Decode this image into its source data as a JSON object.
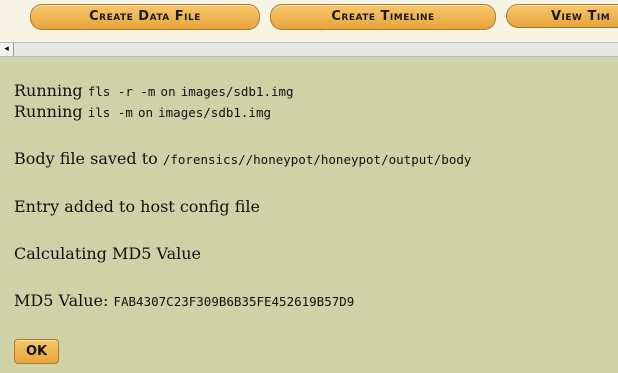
{
  "nav": {
    "tabs": [
      {
        "label": "Create Data File"
      },
      {
        "label": "Create Timeline"
      },
      {
        "label": "View Tim"
      }
    ]
  },
  "scrollbar": {
    "left_arrow": "◂"
  },
  "output": {
    "line1": {
      "prefix": "Running",
      "cmd": "fls -r -m",
      "mid": "on",
      "path": "images/sdb1.img"
    },
    "line2": {
      "prefix": "Running",
      "cmd": "ils -m",
      "mid": "on",
      "path": "images/sdb1.img"
    },
    "line3": {
      "prefix": "Body file saved to",
      "path": "/forensics//honeypot/honeypot/output/body"
    },
    "line4": {
      "text": "Entry added to host config file"
    },
    "line5": {
      "text": "Calculating MD5 Value"
    },
    "line6": {
      "label": "MD5 Value:",
      "value": "FAB4307C23F309B6B35FE452619B57D9"
    }
  },
  "ok_button": {
    "label": "OK"
  },
  "colors": {
    "content_bg": "#cfd1a6",
    "tab_bg": "#eeb24f",
    "top_bg": "#f7f4e6"
  }
}
